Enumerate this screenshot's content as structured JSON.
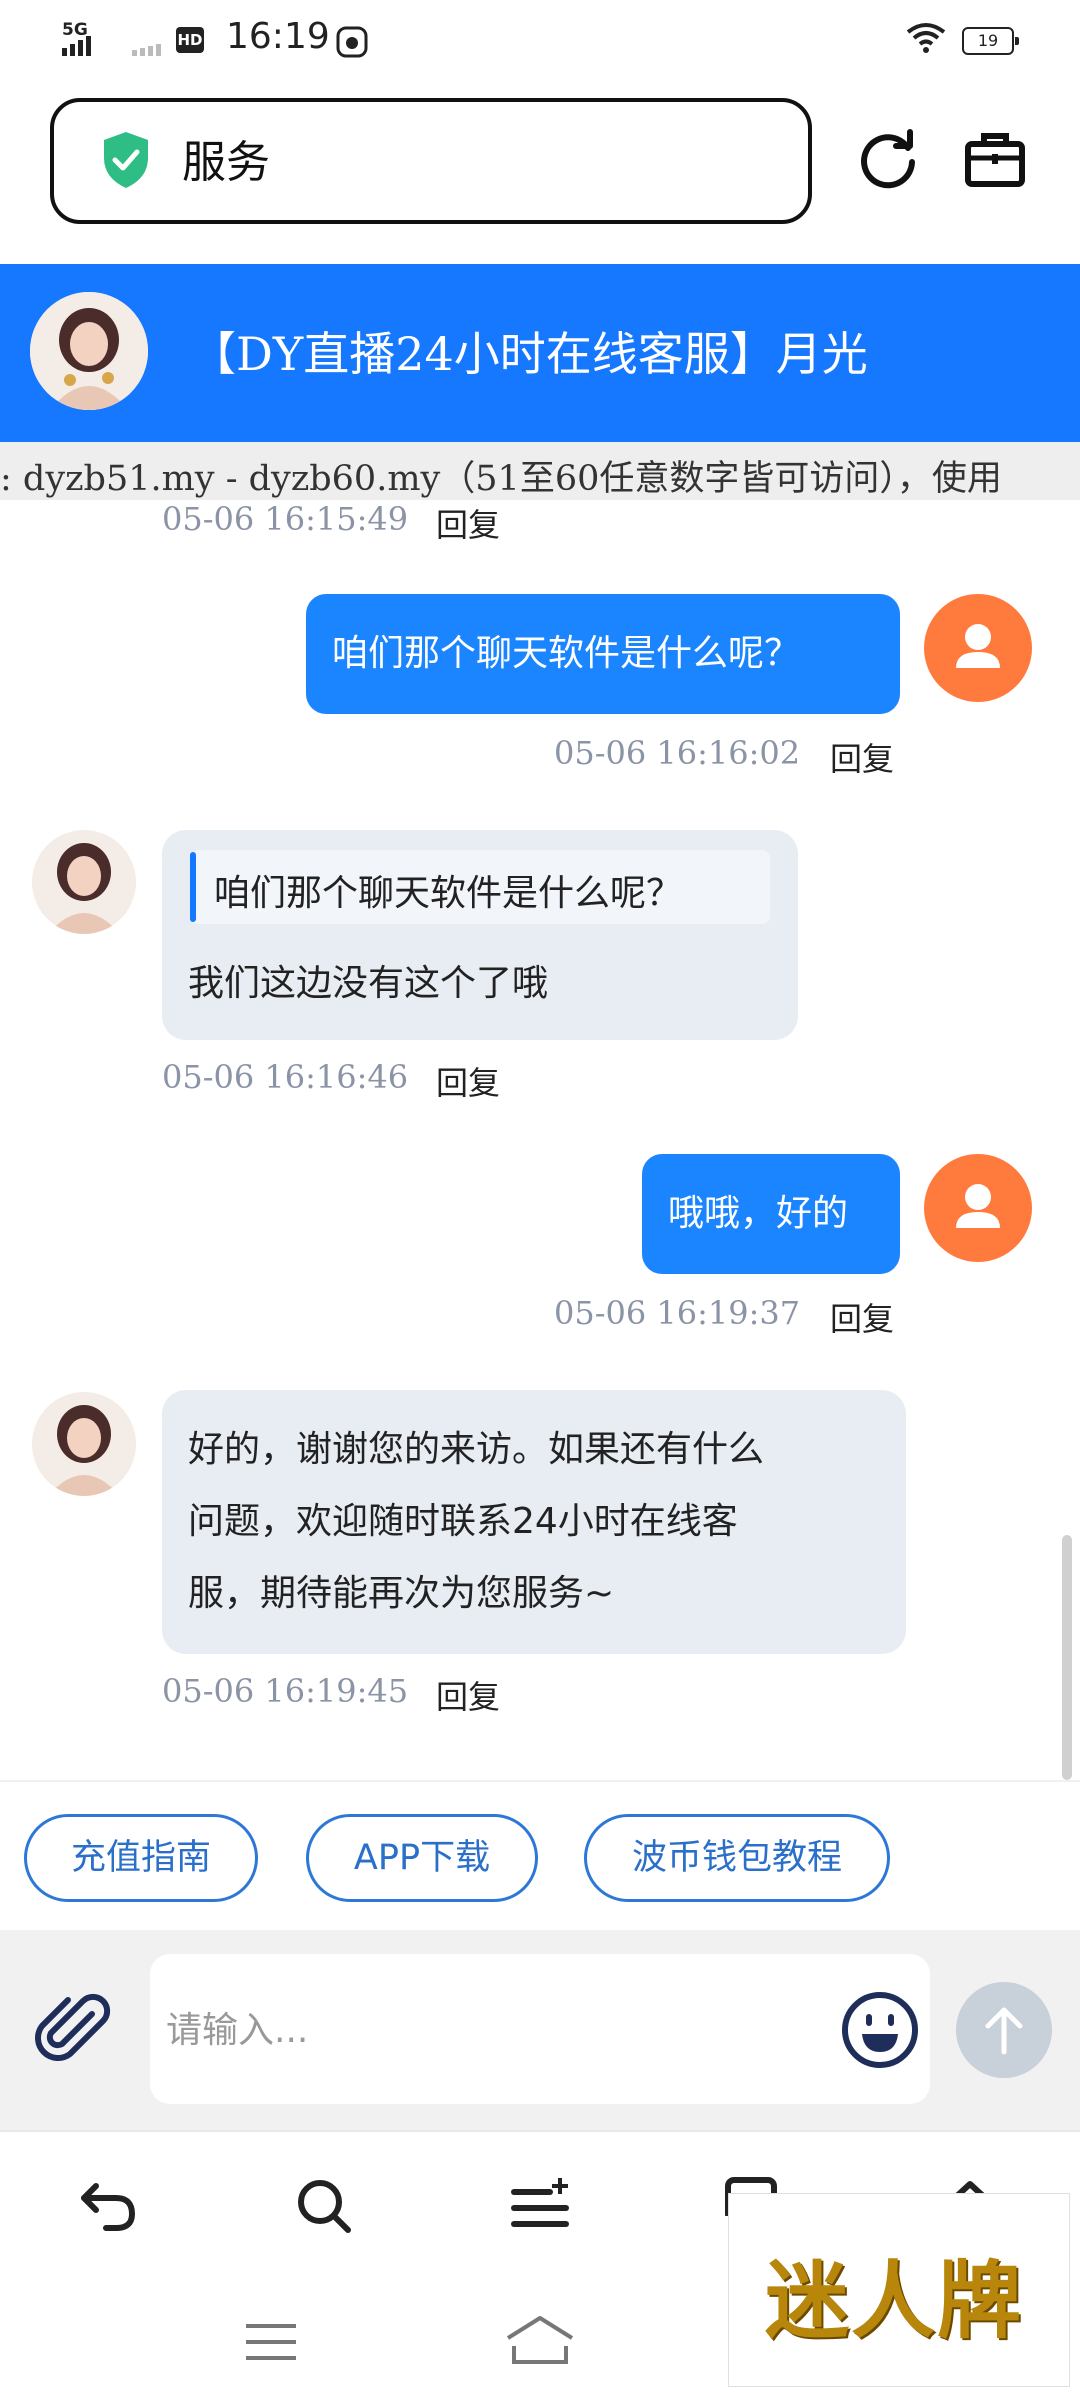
{
  "status_bar": {
    "network": "5G",
    "hd_label": "HD",
    "time": "16:19",
    "battery": "19"
  },
  "address_bar": {
    "text": "服务"
  },
  "chat_header": {
    "title": "【DY直播24小时在线客服】月光"
  },
  "marquee": {
    "text": ": dyzb51.my - dyzb60.my（51至60任意数字皆可访问），使用"
  },
  "messages": [
    {
      "time": "05-06 16:15:49",
      "reply": "回复"
    },
    {
      "text": "咱们那个聊天软件是什么呢？",
      "time": "05-06 16:16:02",
      "reply": "回复"
    },
    {
      "quote": "咱们那个聊天软件是什么呢？",
      "text": "我们这边没有这个了哦",
      "time": "05-06 16:16:46",
      "reply": "回复"
    },
    {
      "text": "哦哦，好的",
      "time": "05-06 16:19:37",
      "reply": "回复"
    },
    {
      "lines": [
        "好的，谢谢您的来访。如果还有什么",
        "问题，欢迎随时联系24小时在线客",
        "服，期待能再次为您服务~"
      ],
      "time": "05-06 16:19:45",
      "reply": "回复"
    }
  ],
  "quick_replies": [
    "充值指南",
    "APP下载",
    "波币钱包教程"
  ],
  "input": {
    "placeholder": "请输入..."
  },
  "watermark": {
    "text": "迷人牌"
  },
  "colors": {
    "accent": "#1677ff",
    "user_avatar": "#ff7a3d",
    "bubble_in": "#e8edf4"
  }
}
